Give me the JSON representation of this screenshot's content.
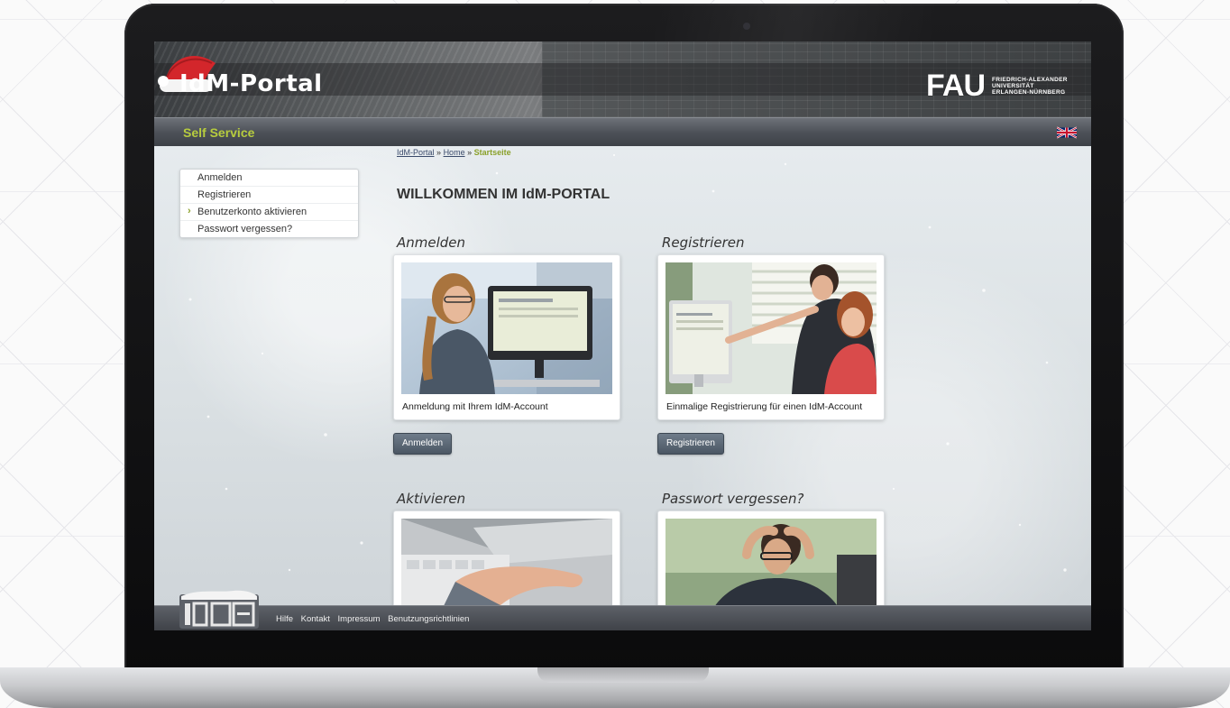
{
  "site": {
    "logo_text": "IdM-Portal",
    "university_mark": "FAU",
    "university_name_lines": [
      "FRIEDRICH-ALEXANDER",
      "UNIVERSITÄT",
      "ERLANGEN-NÜRNBERG"
    ]
  },
  "navbar": {
    "title": "Self Service",
    "language_icon": "uk-flag-icon"
  },
  "breadcrumb": {
    "items": [
      "IdM-Portal",
      "Home"
    ],
    "separator": "»",
    "current": "Startseite"
  },
  "sidebar": {
    "items": [
      {
        "label": "Anmelden"
      },
      {
        "label": "Registrieren"
      },
      {
        "label": "Benutzerkonto aktivieren"
      },
      {
        "label": "Passwort vergessen?"
      }
    ]
  },
  "main": {
    "title": "WILLKOMMEN IM IdM-PORTAL",
    "sections": [
      {
        "heading": "Anmelden",
        "caption": "Anmeldung mit Ihrem IdM-Account",
        "button": "Anmelden"
      },
      {
        "heading": "Registrieren",
        "caption": "Einmalige Registrierung für einen IdM-Account",
        "button": "Registrieren"
      },
      {
        "heading": "Aktivieren"
      },
      {
        "heading": "Passwort vergessen?"
      }
    ]
  },
  "footer": {
    "links": [
      "Hilfe",
      "Kontakt",
      "Impressum",
      "Benutzungsrichtlinien"
    ]
  },
  "colors": {
    "accent_green": "#b7cc3e",
    "active_green": "#8aa02a",
    "navbar": "#4d5158",
    "button": "#4b5764"
  }
}
